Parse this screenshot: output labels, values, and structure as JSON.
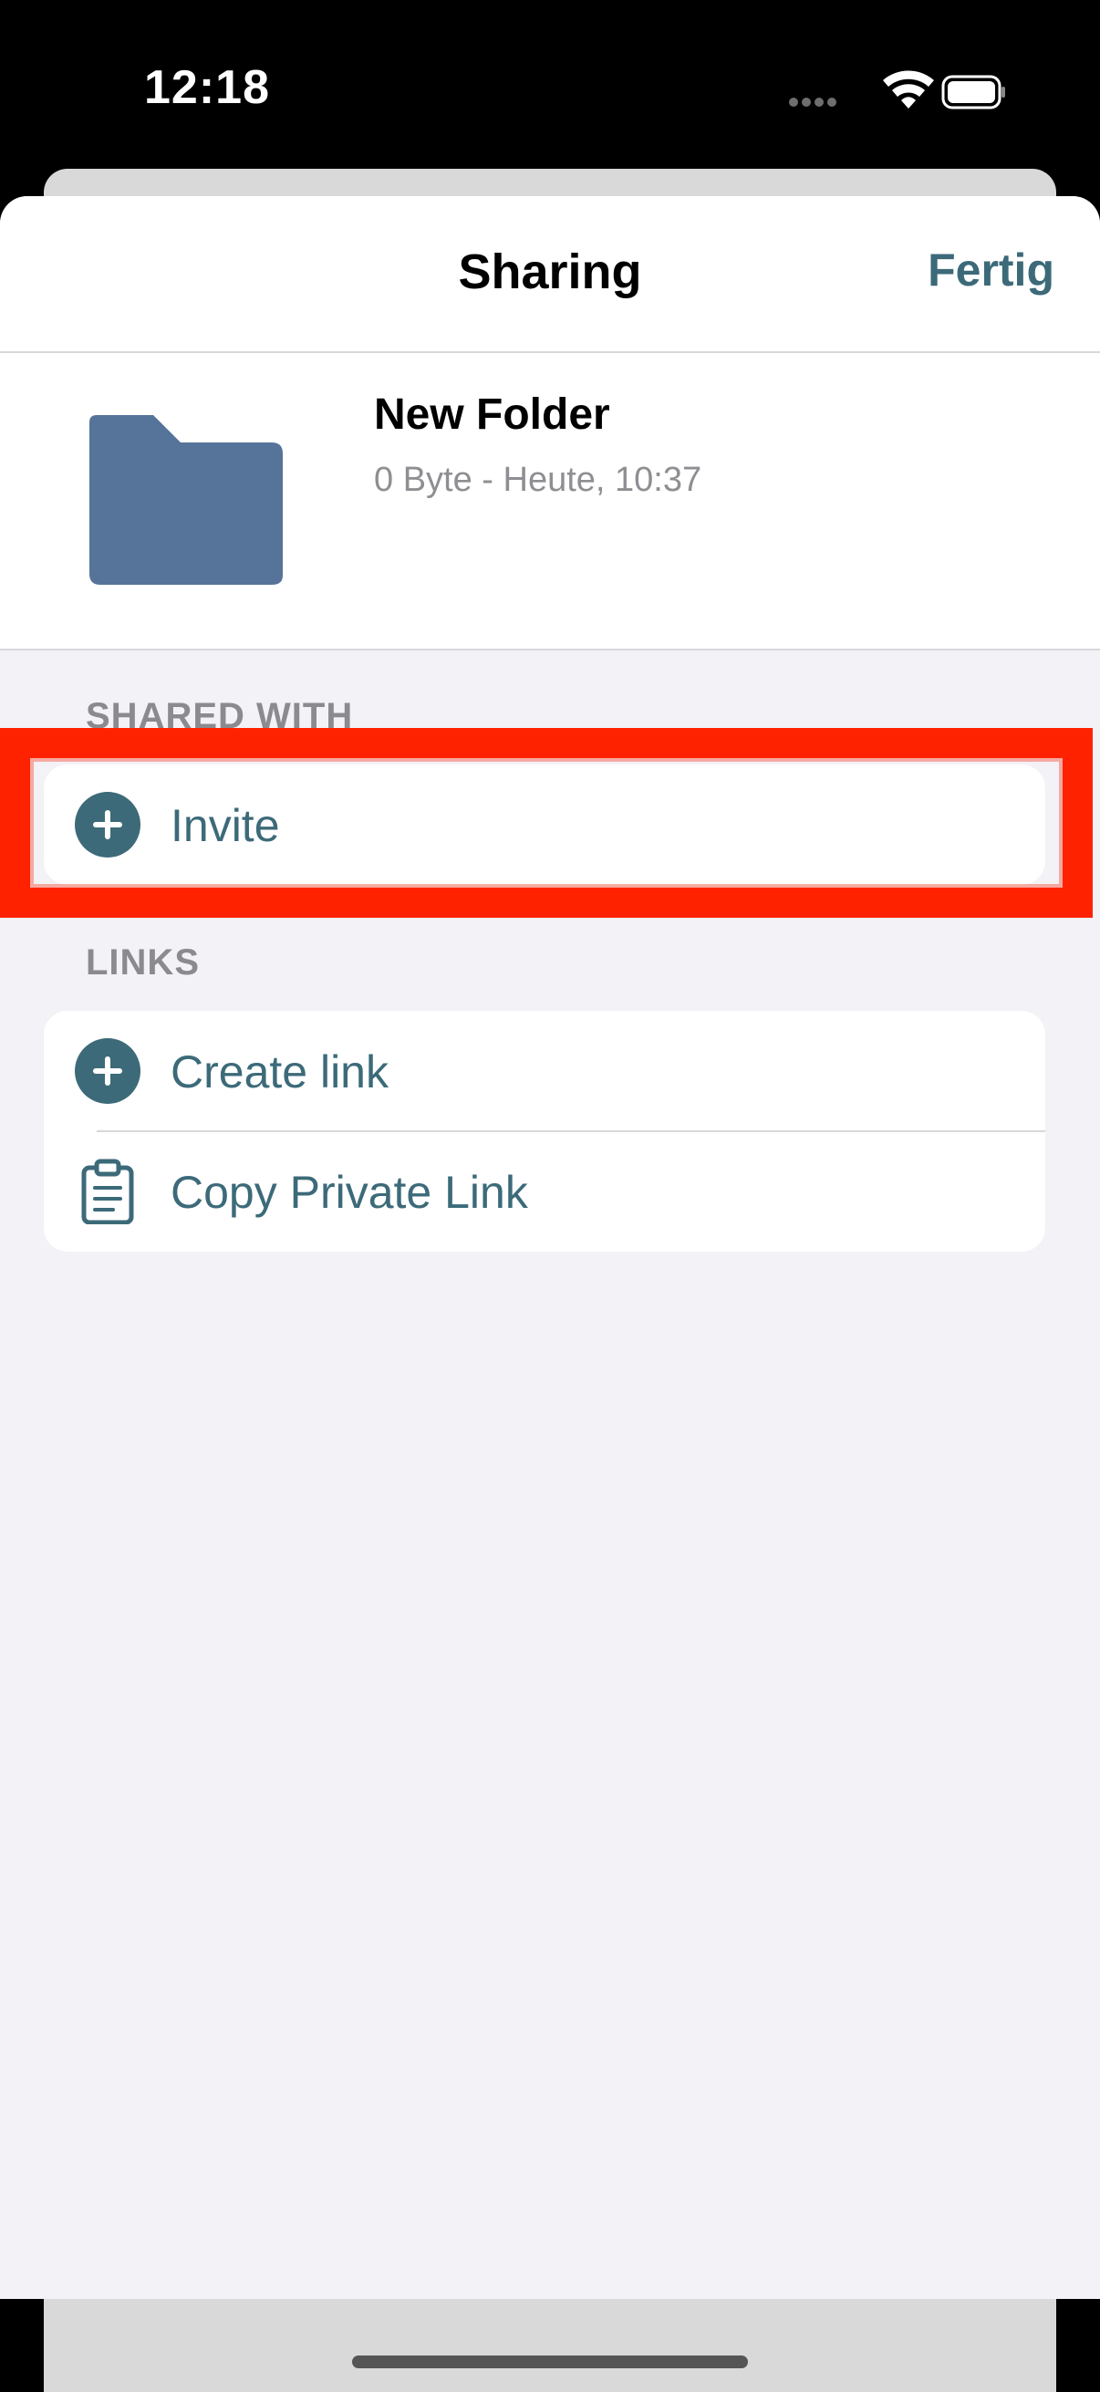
{
  "status_bar": {
    "time": "12:18"
  },
  "nav": {
    "title": "Sharing",
    "done_label": "Fertig"
  },
  "item": {
    "name": "New Folder",
    "meta": "0 Byte - Heute, 10:37",
    "icon": "folder-icon"
  },
  "shared_with": {
    "header": "SHARED WITH",
    "rows": [
      {
        "label": "Invite",
        "icon": "plus-circle-icon"
      }
    ]
  },
  "links": {
    "header": "LINKS",
    "rows": [
      {
        "label": "Create link",
        "icon": "plus-circle-icon"
      },
      {
        "label": "Copy Private Link",
        "icon": "clipboard-icon"
      }
    ]
  },
  "colors": {
    "accent": "#3c6a79",
    "folder": "#56739a",
    "highlight": "#ff2200",
    "background": "#f2f2f7"
  }
}
